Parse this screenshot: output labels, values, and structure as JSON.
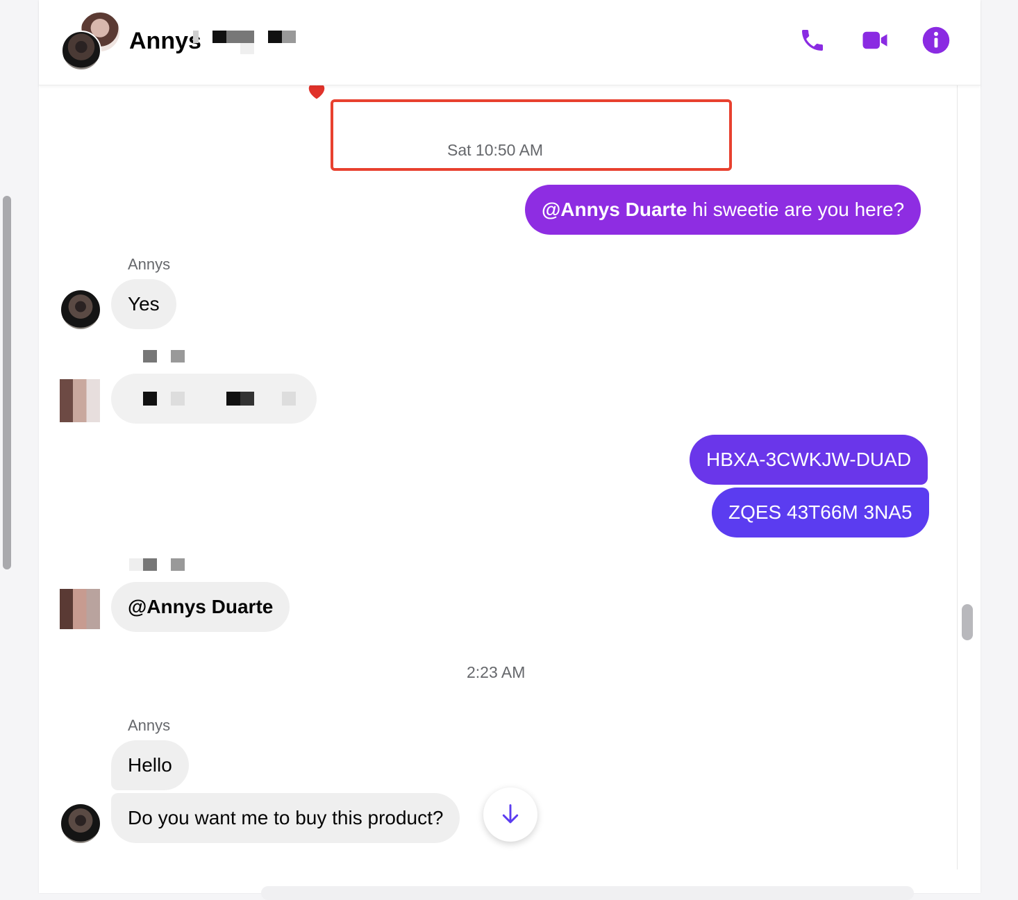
{
  "header": {
    "contact_name": "Annys",
    "icons": [
      "phone-icon",
      "video-icon",
      "info-icon"
    ]
  },
  "colors": {
    "accent": "#8a2be2",
    "outgoing_top": "#8e2de2",
    "outgoing_bottom": "#5b3cf0",
    "highlight": "#e8412f"
  },
  "timestamps": {
    "first": "Sat 10:50 AM",
    "second": "2:23 AM"
  },
  "messages": [
    {
      "direction": "outgoing",
      "mention": "@Annys Duarte",
      "text": " hi sweetie are you here?"
    },
    {
      "direction": "incoming",
      "sender": "Annys",
      "text": "Yes"
    },
    {
      "direction": "outgoing",
      "text": "HBXA-3CWKJW-DUAD"
    },
    {
      "direction": "outgoing",
      "text": "ZQES 43T66M 3NA5"
    },
    {
      "direction": "incoming",
      "text": "@Annys Duarte"
    },
    {
      "direction": "incoming",
      "sender": "Annys",
      "text": "Hello"
    },
    {
      "direction": "incoming",
      "text": "Do you want me to buy this product?"
    }
  ]
}
